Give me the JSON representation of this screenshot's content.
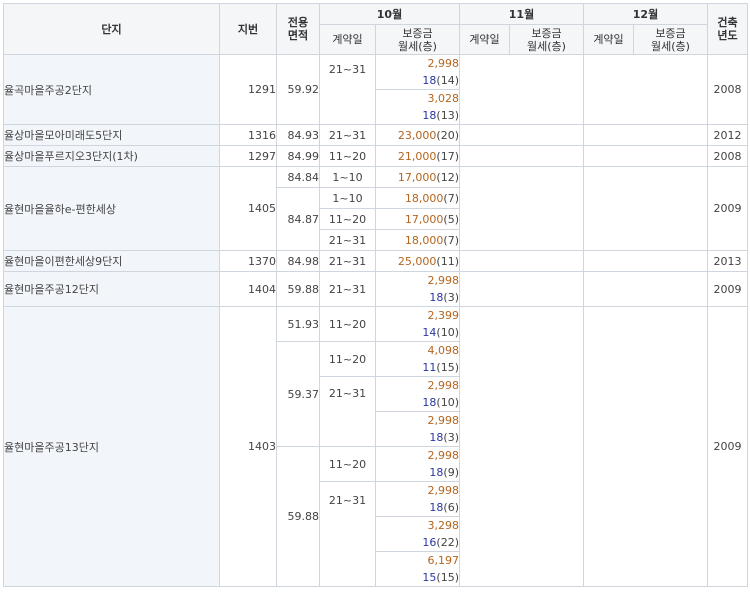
{
  "headers": {
    "complex": "단지",
    "lot": "지번",
    "area": "전용\n면적",
    "months": [
      "10월",
      "11월",
      "12월"
    ],
    "contract_date": "계약일",
    "deposit_rent": "보증금\n월세(층)",
    "built_year": "건축\n년도"
  },
  "rows": [
    {
      "complex": "율곡마을주공2단지",
      "lot": "1291",
      "area": "59.92",
      "date": "21~31",
      "deposit": "2,998",
      "rent": "18",
      "floor": "(14)",
      "year": "2008"
    },
    {
      "deposit": "3,028",
      "rent": "18",
      "floor": "(13)"
    },
    {
      "complex": "율상마을모아미래도5단지",
      "lot": "1316",
      "area": "84.93",
      "date": "21~31",
      "deposit": "23,000",
      "floor": "(20)",
      "year": "2012"
    },
    {
      "complex": "율상마을푸르지오3단지(1차)",
      "lot": "1297",
      "area": "84.99",
      "date": "11~20",
      "deposit": "21,000",
      "floor": "(17)",
      "year": "2008"
    },
    {
      "complex": "율현마을율하e-편한세상",
      "lot": "1405",
      "area": "84.84",
      "date": "1~10",
      "deposit": "17,000",
      "floor": "(12)",
      "year": "2009"
    },
    {
      "area": "84.87",
      "date": "1~10",
      "deposit": "18,000",
      "floor": "(7)"
    },
    {
      "date": "11~20",
      "deposit": "17,000",
      "floor": "(5)"
    },
    {
      "date": "21~31",
      "deposit": "18,000",
      "floor": "(7)"
    },
    {
      "complex": "율현마을이편한세상9단지",
      "lot": "1370",
      "area": "84.98",
      "date": "21~31",
      "deposit": "25,000",
      "floor": "(11)",
      "year": "2013"
    },
    {
      "complex": "율현마을주공12단지",
      "lot": "1404",
      "area": "59.88",
      "date": "21~31",
      "deposit": "2,998",
      "rent": "18",
      "floor": "(3)",
      "year": "2009"
    },
    {
      "complex": "율현마을주공13단지",
      "lot": "1403",
      "area": "51.93",
      "date": "11~20",
      "deposit": "2,399",
      "rent": "14",
      "floor": "(10)",
      "year": "2009"
    },
    {
      "area": "59.37",
      "date": "11~20",
      "deposit": "4,098",
      "rent": "11",
      "floor": "(15)"
    },
    {
      "date": "21~31",
      "deposit": "2,998",
      "rent": "18",
      "floor": "(10)"
    },
    {
      "deposit": "2,998",
      "rent": "18",
      "floor": "(3)"
    },
    {
      "area": "59.88",
      "date": "11~20",
      "deposit": "2,998",
      "rent": "18",
      "floor": "(9)"
    },
    {
      "date": "21~31",
      "deposit": "2,998",
      "rent": "18",
      "floor": "(6)"
    },
    {
      "deposit": "3,298",
      "rent": "16",
      "floor": "(22)"
    },
    {
      "deposit": "6,197",
      "rent": "15",
      "floor": "(15)"
    }
  ]
}
